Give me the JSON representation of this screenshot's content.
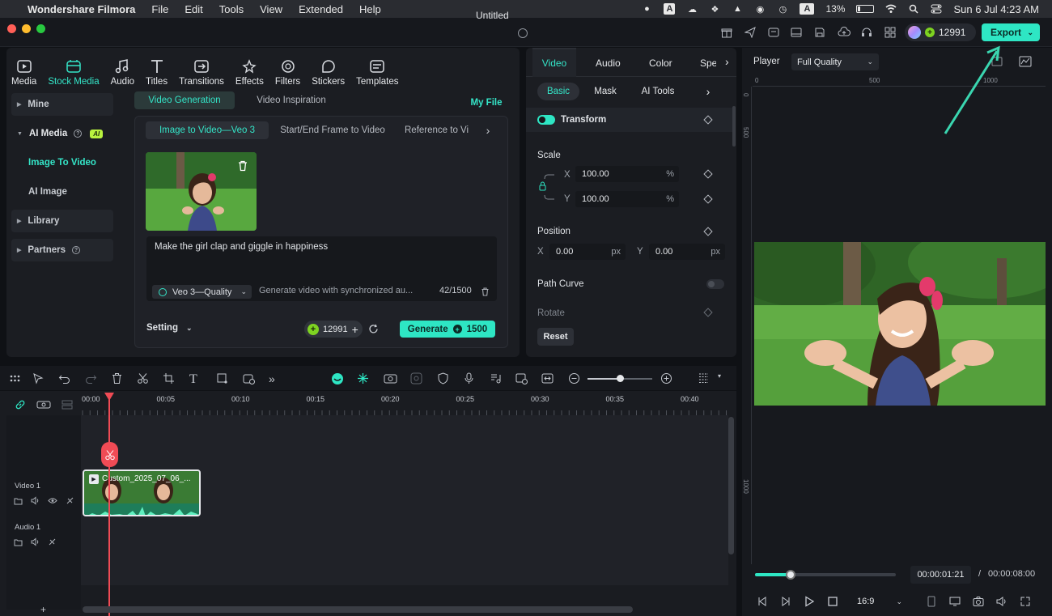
{
  "menubar": {
    "app_name": "Wondershare Filmora",
    "items": [
      "File",
      "Edit",
      "Tools",
      "View",
      "Extended",
      "Help"
    ],
    "battery": "13%",
    "clock": "Sun 6 Jul  4:23 AM",
    "input_source": "A"
  },
  "titlebar": {
    "title": "Untitled",
    "credits": "12991",
    "export_label": "Export"
  },
  "media_tabs": [
    {
      "label": "Media",
      "icon": "media-icon"
    },
    {
      "label": "Stock Media",
      "icon": "stock-media-icon"
    },
    {
      "label": "Audio",
      "icon": "music-note-icon"
    },
    {
      "label": "Titles",
      "icon": "titles-icon"
    },
    {
      "label": "Transitions",
      "icon": "transitions-icon"
    },
    {
      "label": "Effects",
      "icon": "effects-icon"
    },
    {
      "label": "Filters",
      "icon": "filters-icon"
    },
    {
      "label": "Stickers",
      "icon": "stickers-icon"
    },
    {
      "label": "Templates",
      "icon": "templates-icon"
    }
  ],
  "sidebar": {
    "mine": "Mine",
    "ai_media": "AI Media",
    "ai_badge": "AI",
    "image_to_video": "Image To Video",
    "ai_image": "AI Image",
    "library": "Library",
    "partners": "Partners"
  },
  "subtabs": {
    "video_generation": "Video Generation",
    "video_inspiration": "Video Inspiration",
    "my_file": "My File"
  },
  "mode_tabs": [
    "Image to Video—Veo 3",
    "Start/End Frame to Video",
    "Reference to Vi"
  ],
  "prompt": {
    "text": "Make the girl clap and giggle in happiness",
    "model": "Veo 3—Quality",
    "hint": "Generate video with synchronized au...",
    "count": "42/1500"
  },
  "generate": {
    "setting_label": "Setting",
    "credits": "12991",
    "button_label": "Generate",
    "cost": "1500"
  },
  "properties": {
    "tabs": [
      "Video",
      "Audio",
      "Color",
      "Spe"
    ],
    "subtabs": [
      "Basic",
      "Mask",
      "AI Tools"
    ],
    "transform_label": "Transform",
    "scale_label": "Scale",
    "scale_x": "100.00",
    "scale_y": "100.00",
    "percent_unit": "%",
    "position_label": "Position",
    "pos_x": "0.00",
    "pos_y": "0.00",
    "px_unit": "px",
    "x_label": "X",
    "y_label": "Y",
    "path_curve_label": "Path Curve",
    "rotate_label": "Rotate",
    "reset_label": "Reset"
  },
  "player": {
    "label": "Player",
    "quality": "Full Quality",
    "ruler_marks": [
      "0",
      "500",
      "1000"
    ],
    "vruler_marks": [
      "0",
      "500",
      "1000"
    ],
    "current_time": "00:00:01:21",
    "separator": "/",
    "total_time": "00:00:08:00",
    "ratio": "16:9",
    "progress_fraction": 0.25
  },
  "timeline": {
    "ruler": [
      "00:00",
      "00:05",
      "00:10",
      "00:15",
      "00:20",
      "00:25",
      "00:30",
      "00:35",
      "00:40"
    ],
    "video_track": "Video 1",
    "audio_track": "Audio 1",
    "clip_name": "Custom_2025_07_06_..."
  },
  "colors": {
    "accent": "#2ee6c4",
    "playhead": "#f04b55",
    "annotation_arrow": "#3ad6b0"
  }
}
